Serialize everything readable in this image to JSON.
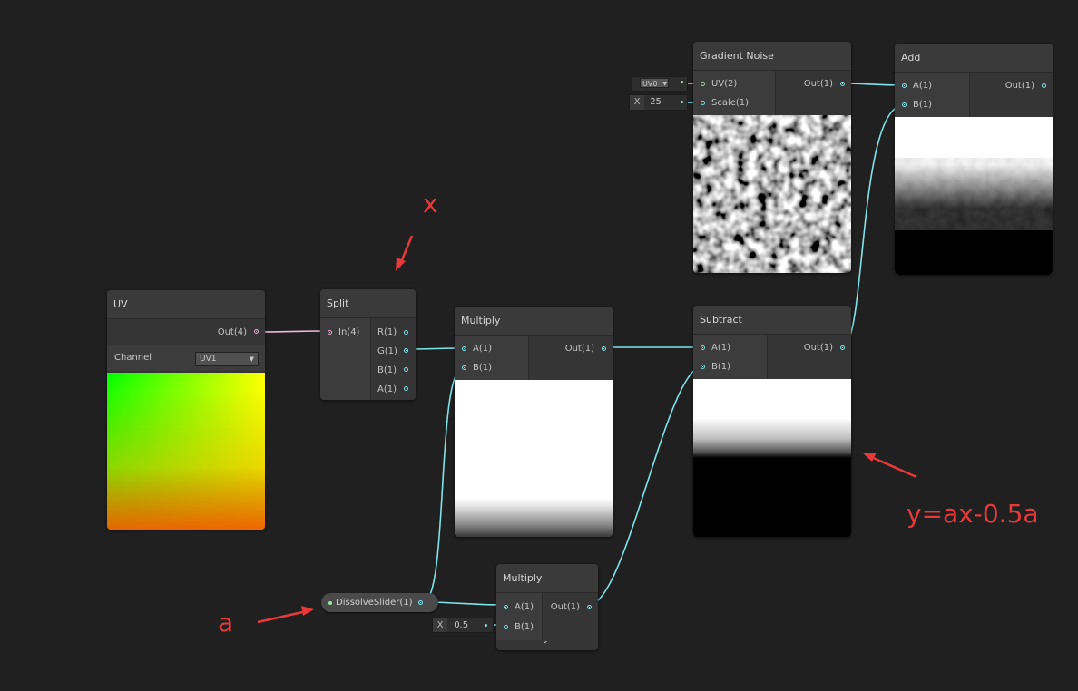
{
  "nodes": {
    "uv": {
      "title": "UV",
      "output": "Out(4)",
      "channel_label": "Channel",
      "channel_value": "UV1"
    },
    "split": {
      "title": "Split",
      "input": "In(4)",
      "outputs": [
        "R(1)",
        "G(1)",
        "B(1)",
        "A(1)"
      ]
    },
    "multiply1": {
      "title": "Multiply",
      "inputs": [
        "A(1)",
        "B(1)"
      ],
      "output": "Out(1)"
    },
    "subtract": {
      "title": "Subtract",
      "inputs": [
        "A(1)",
        "B(1)"
      ],
      "output": "Out(1)"
    },
    "gradient_noise": {
      "title": "Gradient Noise",
      "inputs": [
        "UV(2)",
        "Scale(1)"
      ],
      "output": "Out(1)",
      "uv_dropdown": "UV0",
      "scale_x_label": "X",
      "scale_value": "25"
    },
    "add": {
      "title": "Add",
      "inputs": [
        "A(1)",
        "B(1)"
      ],
      "output": "Out(1)"
    },
    "multiply2": {
      "title": "Multiply",
      "inputs": [
        "A(1)",
        "B(1)"
      ],
      "output": "Out(1)",
      "b_x_label": "X",
      "b_value": "0.5"
    },
    "property": {
      "label": "DissolveSlider(1)"
    }
  },
  "annotations": {
    "x_label": "x",
    "a_label": "a",
    "formula": "y=ax-0.5a"
  },
  "colors": {
    "background": "#202020",
    "node_body": "#353535",
    "wire_float": "#7fe3e8",
    "wire_vector4": "#f0a7d2",
    "annotation": "#e8393a"
  }
}
